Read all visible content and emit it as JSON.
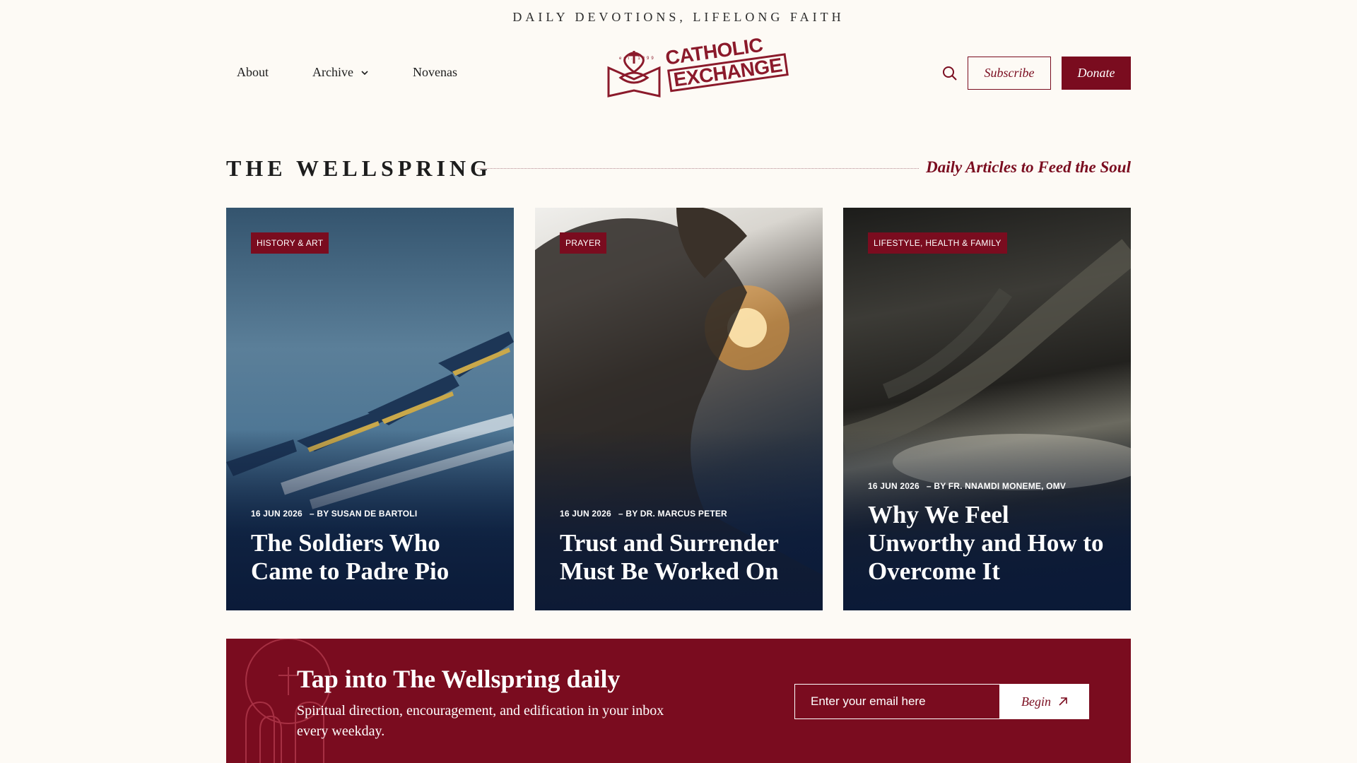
{
  "header": {
    "tagline": "DAILY DEVOTIONS, LIFELONG FAITH",
    "nav": [
      {
        "label": "About"
      },
      {
        "label": "Archive"
      },
      {
        "label": "Novenas"
      }
    ],
    "logo": {
      "line1": "CATHOLIC",
      "line2": "EXCHANGE",
      "est": "est. 1999"
    },
    "subscribe_label": "Subscribe",
    "donate_label": "Donate",
    "brand_color": "#7a0c1f"
  },
  "section": {
    "title": "THE WELLSPRING",
    "subtitle": "Daily Articles to Feed the Soul"
  },
  "articles": [
    {
      "category": "HISTORY & ART",
      "date": "16 JUN 2026",
      "byline": "– BY SUSAN DE BARTOLI",
      "title": "The Soldiers Who Came to Padre Pio"
    },
    {
      "category": "PRAYER",
      "date": "16 JUN 2026",
      "byline": "– BY DR. MARCUS PETER",
      "title": "Trust and Surrender Must Be Worked On"
    },
    {
      "category": "LIFESTYLE, HEALTH & FAMILY",
      "date": "16 JUN 2026",
      "byline": "– BY FR. NNAMDI MONEME, OMV",
      "title": "Why We Feel Unworthy and How to Overcome It"
    }
  ],
  "cta": {
    "title": "Tap into The Wellspring daily",
    "description": "Spiritual direction, encouragement, and edification in your inbox every weekday.",
    "email_placeholder": "Enter your email here",
    "button_label": "Begin"
  }
}
